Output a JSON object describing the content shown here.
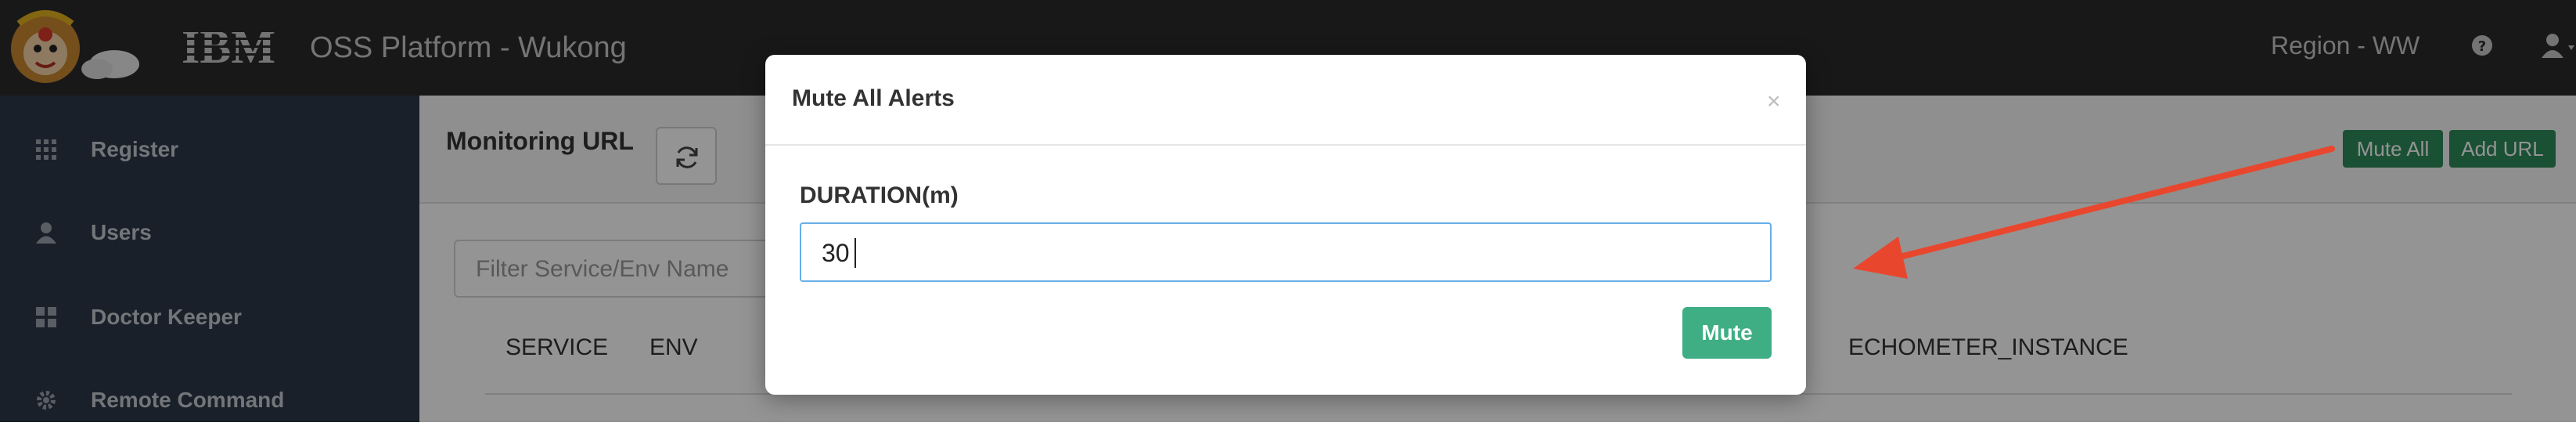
{
  "header": {
    "brand": "IBM",
    "app_title": "OSS Platform - Wukong",
    "region": "Region - WW"
  },
  "sidebar": {
    "items": [
      {
        "label": "Register",
        "icon": "grid-icon"
      },
      {
        "label": "Users",
        "icon": "user-icon"
      },
      {
        "label": "Doctor Keeper",
        "icon": "dashboard-icon"
      },
      {
        "label": "Remote Command",
        "icon": "gear-icon"
      }
    ]
  },
  "main": {
    "title": "Monitoring URL",
    "mute_all_label": "Mute All",
    "add_url_label": "Add URL",
    "filter_placeholder": "Filter Service/Env Name",
    "columns": [
      "SERVICE",
      "ENV",
      "ECHOMETER_INSTANCE"
    ]
  },
  "modal": {
    "title": "Mute All Alerts",
    "close_label": "×",
    "duration_label": "DURATION(m)",
    "duration_value": "30",
    "mute_label": "Mute"
  },
  "colors": {
    "topbar": "#2a2a2a",
    "sidebar": "#2b3748",
    "primary_green": "#2e8a5a",
    "mute_button": "#3fae85",
    "input_focus": "#66afe9",
    "annotation_arrow": "#e8472e"
  }
}
